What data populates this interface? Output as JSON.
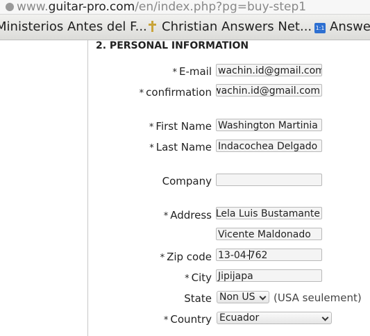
{
  "browser": {
    "url_prefix": "www.",
    "url_domain": "guitar-pro.com",
    "url_path": "/en/index.php?pg=buy-step1",
    "bookmarks": [
      {
        "label": "Ministerios Antes del F..."
      },
      {
        "label": "Christian Answers Net..."
      },
      {
        "label": "Answe",
        "icon_text": "1:1"
      }
    ]
  },
  "form": {
    "section_title": "2. PERSONAL INFORMATION",
    "required_mark": "*",
    "fields": {
      "email": {
        "label": "E-mail",
        "value": "wachin.id@gmail.com"
      },
      "confirmation": {
        "label": "confirmation",
        "value": "wachin.id@gmail.com"
      },
      "first_name": {
        "label": "First Name",
        "value": "Washington Martinia"
      },
      "last_name": {
        "label": "Last Name",
        "value": "Indacochea Delgado"
      },
      "company": {
        "label": "Company",
        "value": ""
      },
      "address": {
        "label": "Address",
        "value": "Lela Luis Bustamante"
      },
      "address2": {
        "value": "Vicente Maldonado"
      },
      "zip": {
        "label": "Zip code",
        "value_before": "13-04-",
        "value_after": "762"
      },
      "city": {
        "label": "City",
        "value": "Jipijapa"
      },
      "state": {
        "label": "State",
        "value": "Non US",
        "note": "(USA seulement)"
      },
      "country": {
        "label": "Country",
        "value": "Ecuador"
      }
    }
  }
}
